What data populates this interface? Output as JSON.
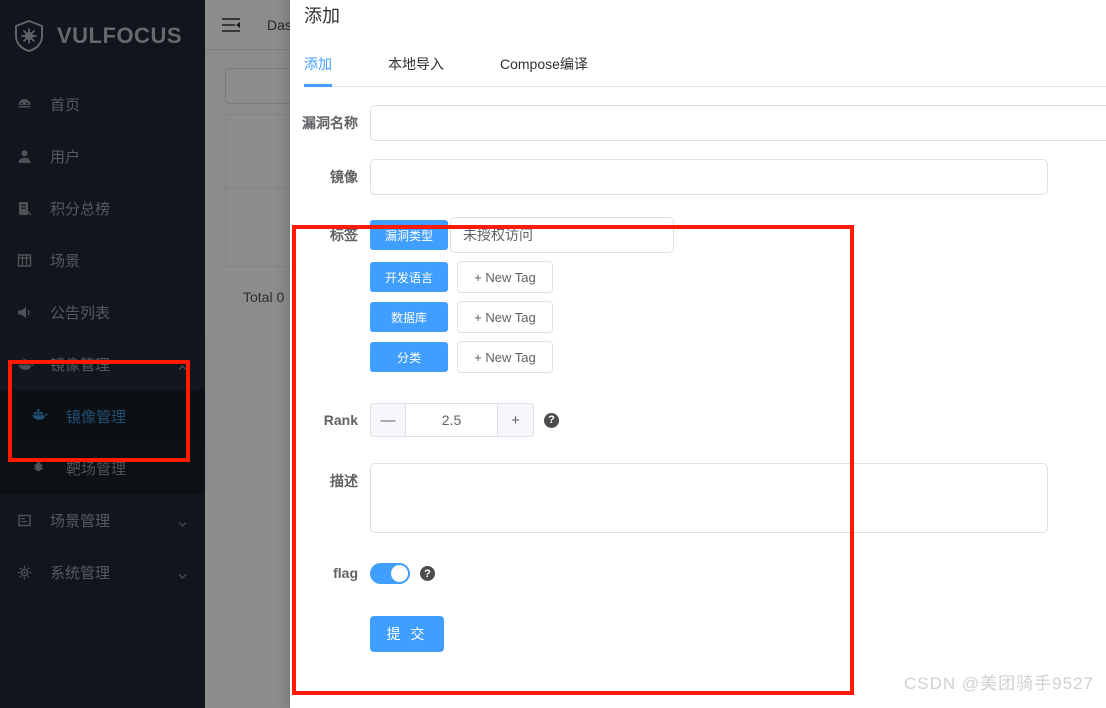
{
  "sidebar": {
    "brand": "VULFOCUS",
    "items": [
      {
        "label": "首页",
        "icon": "dashboard-icon"
      },
      {
        "label": "用户",
        "icon": "user-icon"
      },
      {
        "label": "积分总榜",
        "icon": "ranking-icon"
      },
      {
        "label": "场景",
        "icon": "grid-icon"
      },
      {
        "label": "公告列表",
        "icon": "megaphone-icon"
      },
      {
        "label": "镜像管理",
        "icon": "docker-icon",
        "expanded": true
      },
      {
        "label": "场景管理",
        "icon": "scene-icon"
      },
      {
        "label": "系统管理",
        "icon": "gear-icon"
      }
    ],
    "submenu": [
      {
        "label": "镜像管理",
        "icon": "docker-icon",
        "active": true
      },
      {
        "label": "靶场管理",
        "icon": "bug-icon",
        "active": false
      }
    ]
  },
  "topbar": {
    "collapse_icon": "collapse-menu-icon",
    "breadcrumb": "Dashboard"
  },
  "background": {
    "total_text": "Total 0"
  },
  "modal": {
    "title": "添加",
    "tabs": [
      {
        "label": "添加",
        "active": true
      },
      {
        "label": "本地导入",
        "active": false
      },
      {
        "label": "Compose编译",
        "active": false
      }
    ],
    "fields": {
      "name_label": "漏洞名称",
      "name_value": "",
      "image_label": "镜像",
      "image_value": "",
      "tags_label": "标签",
      "rank_label": "Rank",
      "rank_value": "2.5",
      "rank_minus": "—",
      "rank_plus": "+",
      "desc_label": "描述",
      "desc_value": "",
      "flag_label": "flag",
      "flag_on": true,
      "submit_label": "提 交",
      "help_glyph": "?"
    },
    "tags": [
      {
        "name": "漏洞类型",
        "mode": "input",
        "value": "未授权访问"
      },
      {
        "name": "开发语言",
        "mode": "button",
        "value": "+ New Tag"
      },
      {
        "name": "数据库",
        "mode": "button",
        "value": "+ New Tag"
      },
      {
        "name": "分类",
        "mode": "button",
        "value": "+ New Tag"
      }
    ]
  },
  "colors": {
    "accent": "#409eff",
    "sidebar_bg": "#1f2733",
    "annotation": "#ff1a00"
  },
  "watermark": "CSDN @美团骑手9527"
}
